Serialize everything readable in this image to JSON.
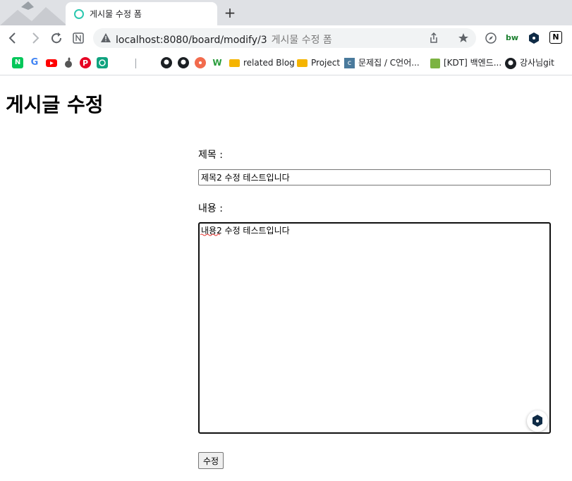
{
  "browser": {
    "tab_title": "게시물 수정 폼",
    "new_tab_label": "+",
    "url": "localhost:8080/board/modify/3",
    "url_hint": "게시물 수정 폼",
    "extensions": [
      "bw",
      "N"
    ],
    "bookmarks": [
      {
        "label": "related Blog"
      },
      {
        "label": "Project"
      },
      {
        "label": "문제집 / C언어..."
      },
      {
        "label": "[KDT] 백엔드..."
      },
      {
        "label": "강사님git"
      }
    ]
  },
  "page": {
    "heading": "게시글 수정",
    "title_label": "제목 :",
    "title_value": "제목2 수정 테스트입니다",
    "content_label": "내용 :",
    "content_value": "내용2 수정 테스트입니다",
    "submit_label": "수정"
  },
  "colors": {
    "tab_bar": "#dfe1e5",
    "omnibox": "#f1f3f4",
    "tab_indicator": "#2cc8b0"
  }
}
